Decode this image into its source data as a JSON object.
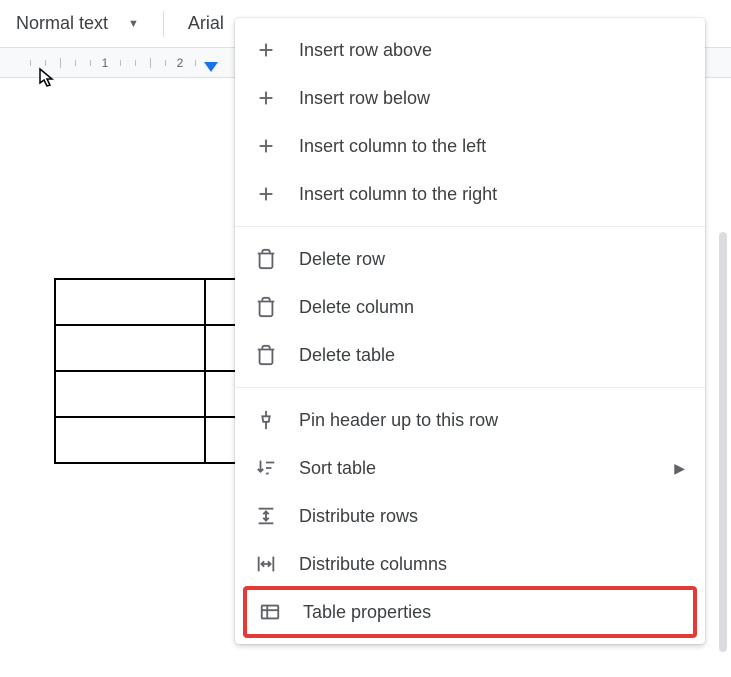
{
  "toolbar": {
    "style_label": "Normal text",
    "font_label": "Arial"
  },
  "ruler": {
    "marks": [
      "1",
      "2"
    ]
  },
  "context_menu": {
    "groups": [
      {
        "items": [
          {
            "icon": "plus-icon",
            "label": "Insert row above"
          },
          {
            "icon": "plus-icon",
            "label": "Insert row below"
          },
          {
            "icon": "plus-icon",
            "label": "Insert column to the left"
          },
          {
            "icon": "plus-icon",
            "label": "Insert column to the right"
          }
        ]
      },
      {
        "items": [
          {
            "icon": "trash-icon",
            "label": "Delete row"
          },
          {
            "icon": "trash-icon",
            "label": "Delete column"
          },
          {
            "icon": "trash-icon",
            "label": "Delete table"
          }
        ]
      },
      {
        "items": [
          {
            "icon": "pin-icon",
            "label": "Pin header up to this row"
          },
          {
            "icon": "sort-icon",
            "label": "Sort table",
            "submenu": true
          },
          {
            "icon": "distribute-rows-icon",
            "label": "Distribute rows"
          },
          {
            "icon": "distribute-columns-icon",
            "label": "Distribute columns"
          },
          {
            "icon": "table-properties-icon",
            "label": "Table properties",
            "highlighted": true
          }
        ]
      }
    ]
  }
}
